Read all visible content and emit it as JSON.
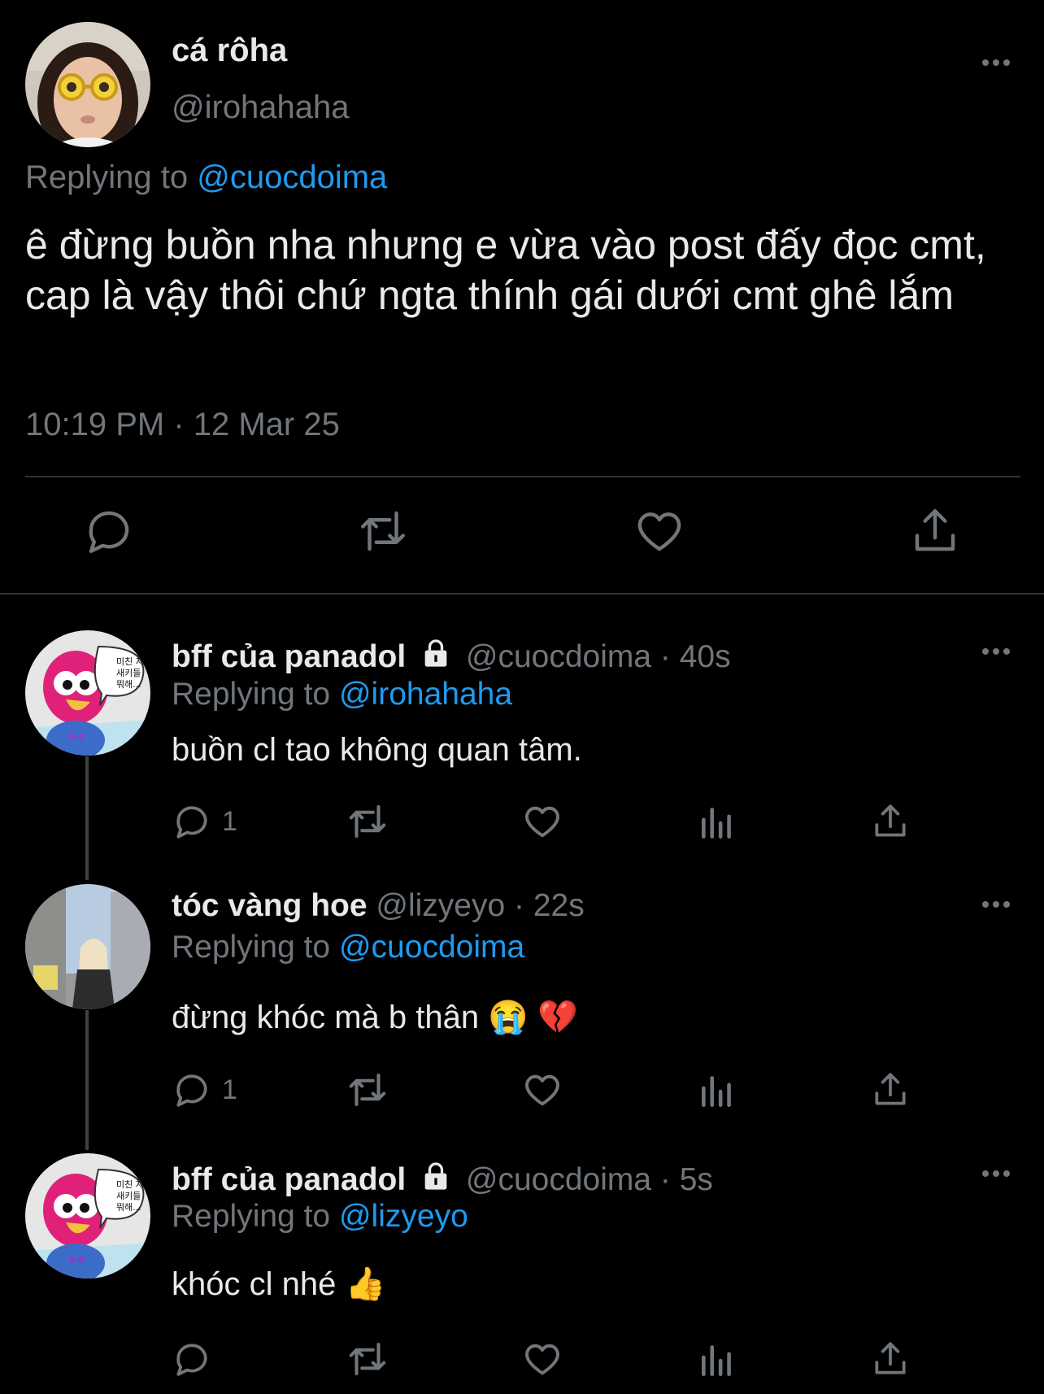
{
  "main_tweet": {
    "display_name": "cá rôha",
    "handle": "@irohahaha",
    "replying_prefix": "Replying to",
    "replying_to": "@cuocdoima",
    "text": "ê đừng buồn nha nhưng e vừa vào post đấy đọc cmt, cap là vậy thôi chứ ngta thính gái dưới cmt ghê lắm",
    "timestamp": "10:19 PM · 12 Mar 25",
    "actions": [
      "reply-icon",
      "retweet-icon",
      "like-icon",
      "share-icon"
    ]
  },
  "replies": [
    {
      "display_name": "bff của panadol",
      "protected": true,
      "handle": "@cuocdoima",
      "age": "· 40s",
      "replying_prefix": "Replying to",
      "replying_to": "@irohahaha",
      "text": "buồn cl tao không quan tâm.",
      "reply_count": "1"
    },
    {
      "display_name": "tóc vàng hoe",
      "protected": false,
      "handle": "@lizyeyo",
      "age": "· 22s",
      "replying_prefix": "Replying to",
      "replying_to": "@cuocdoima",
      "text": "đừng khóc mà b thân 😭 💔",
      "reply_count": "1"
    },
    {
      "display_name": "bff của panadol",
      "protected": true,
      "handle": "@cuocdoima",
      "age": "· 5s",
      "replying_prefix": "Replying to",
      "replying_to": "@lizyeyo",
      "text": "khóc cl nhé 👍",
      "reply_count": ""
    }
  ],
  "colors": {
    "background": "#000000",
    "text": "#e7e9ea",
    "secondary": "#71767b",
    "link": "#1d9bf0",
    "divider": "#2f3336"
  }
}
